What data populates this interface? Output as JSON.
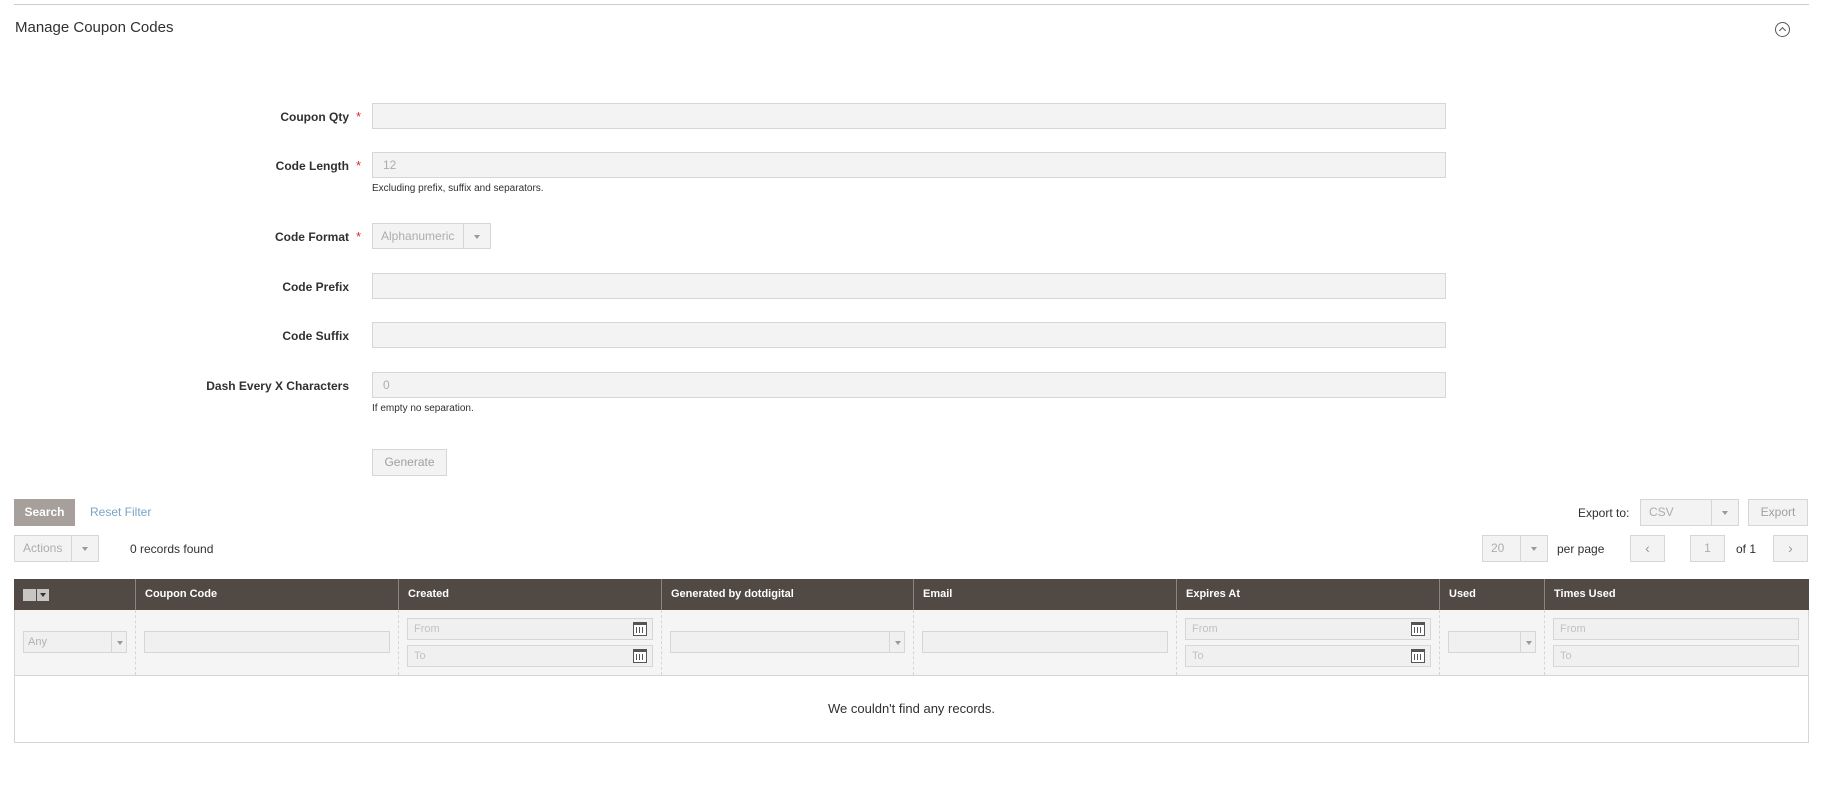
{
  "section": {
    "title": "Manage Coupon Codes",
    "collapse_icon": "chevron-up-circle-icon"
  },
  "form": {
    "coupon_qty": {
      "label": "Coupon Qty",
      "required": true,
      "value": ""
    },
    "code_length": {
      "label": "Code Length",
      "required": true,
      "value": "12",
      "note": "Excluding prefix, suffix and separators."
    },
    "code_format": {
      "label": "Code Format",
      "required": true,
      "value": "Alphanumeric"
    },
    "code_prefix": {
      "label": "Code Prefix",
      "required": false,
      "value": ""
    },
    "code_suffix": {
      "label": "Code Suffix",
      "required": false,
      "value": ""
    },
    "dash_every": {
      "label": "Dash Every X Characters",
      "required": false,
      "value": "0",
      "note": "If empty no separation."
    },
    "required_marker": "*",
    "generate_label": "Generate"
  },
  "toolbar": {
    "search_label": "Search",
    "reset_filter_label": "Reset Filter",
    "actions_label": "Actions",
    "records_found": "0 records found",
    "export_to_label": "Export to:",
    "export_format": "CSV",
    "export_label": "Export",
    "per_page_value": "20",
    "per_page_label": "per page",
    "prev_icon": "‹",
    "next_icon": "›",
    "current_page": "1",
    "of_pages": "of 1"
  },
  "grid": {
    "columns": [
      {
        "key": "mass",
        "label": ""
      },
      {
        "key": "coupon_code",
        "label": "Coupon Code"
      },
      {
        "key": "created",
        "label": "Created"
      },
      {
        "key": "generated_by",
        "label": "Generated by dotdigital"
      },
      {
        "key": "email",
        "label": "Email"
      },
      {
        "key": "expires_at",
        "label": "Expires At"
      },
      {
        "key": "used",
        "label": "Used"
      },
      {
        "key": "times_used",
        "label": "Times Used"
      }
    ],
    "filters": {
      "mass_select": "Any",
      "from_placeholder": "From",
      "to_placeholder": "To"
    },
    "empty_message": "We couldn't find any records."
  }
}
